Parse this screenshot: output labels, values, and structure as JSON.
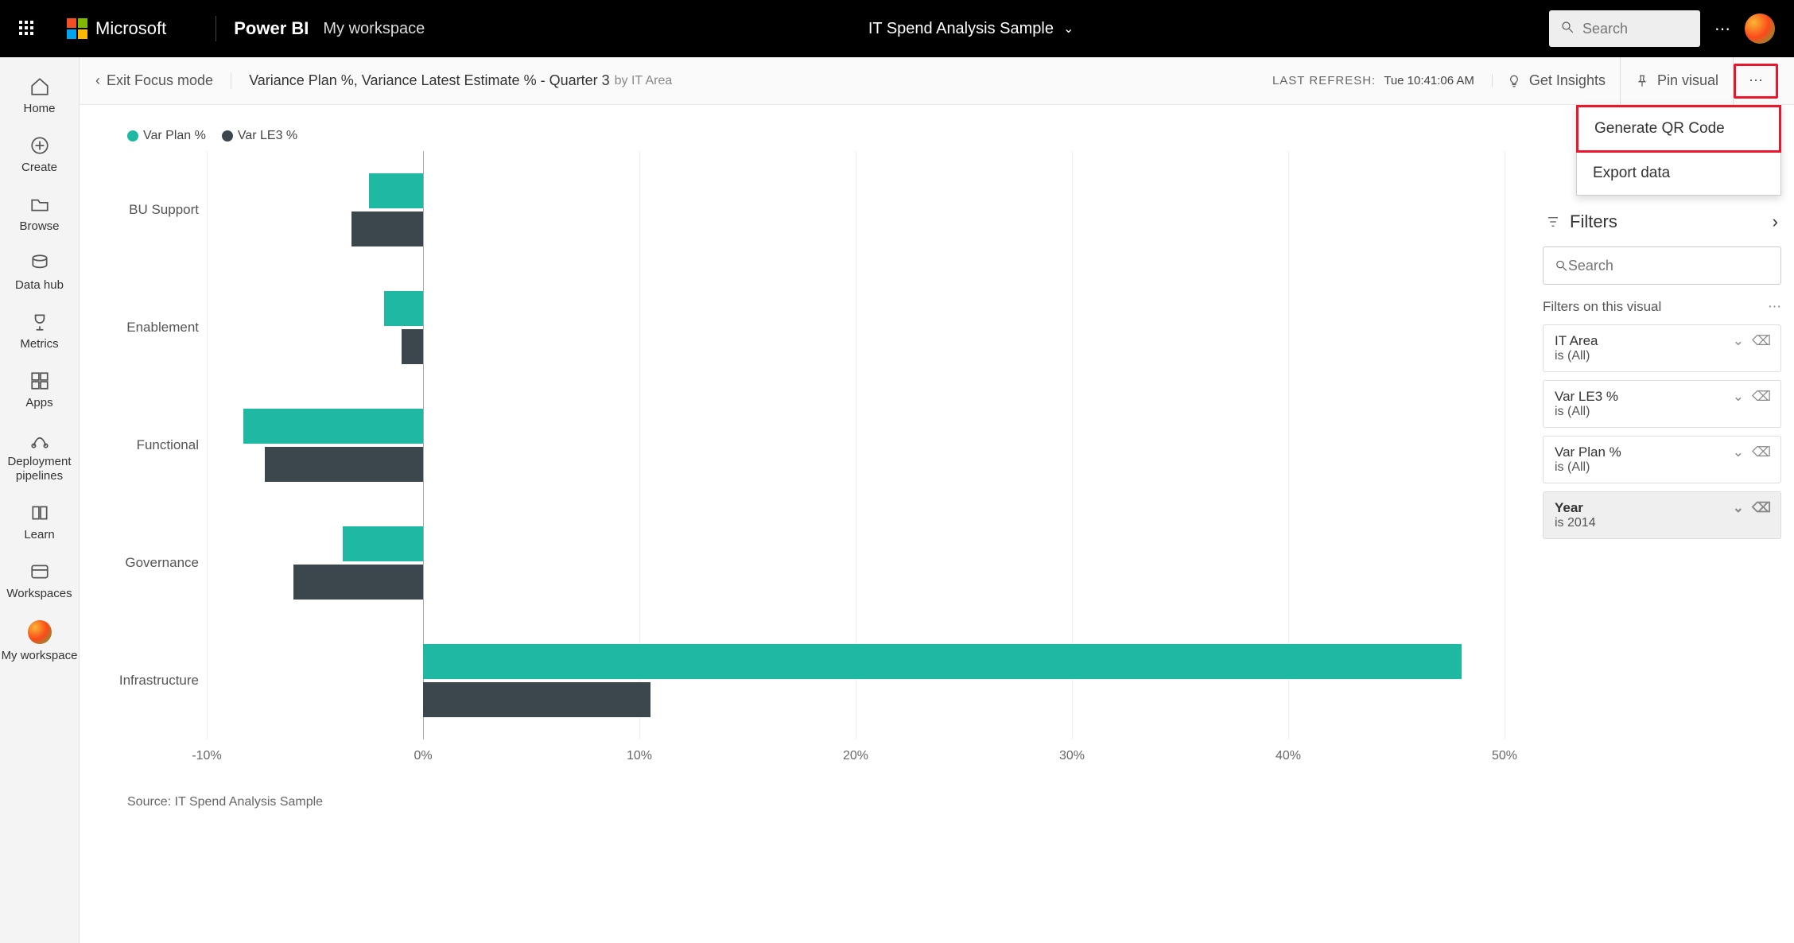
{
  "topbar": {
    "brand": "Microsoft",
    "product": "Power BI",
    "workspace": "My workspace",
    "doc_title": "IT Spend Analysis Sample",
    "search_placeholder": "Search"
  },
  "sidebar": {
    "items": [
      {
        "label": "Home"
      },
      {
        "label": "Create"
      },
      {
        "label": "Browse"
      },
      {
        "label": "Data hub"
      },
      {
        "label": "Metrics"
      },
      {
        "label": "Apps"
      },
      {
        "label": "Deployment pipelines"
      },
      {
        "label": "Learn"
      },
      {
        "label": "Workspaces"
      },
      {
        "label": "My workspace"
      }
    ]
  },
  "subheader": {
    "exit": "Exit Focus mode",
    "title": "Variance Plan %, Variance Latest Estimate % - Quarter 3",
    "subtitle": "by IT Area",
    "refresh_label": "LAST REFRESH:",
    "refresh_time": "Tue 10:41:06 AM",
    "get_insights": "Get Insights",
    "pin_visual": "Pin visual"
  },
  "dropdown": {
    "generate_qr": "Generate QR Code",
    "export_data": "Export data"
  },
  "legend": {
    "var_plan": "Var Plan %",
    "var_le3": "Var LE3 %"
  },
  "source": "Source: IT Spend Analysis Sample",
  "filters": {
    "heading": "Filters",
    "search_placeholder": "Search",
    "subhead": "Filters on this visual",
    "cards": [
      {
        "name": "IT Area",
        "value": "is (All)"
      },
      {
        "name": "Var LE3 %",
        "value": "is (All)"
      },
      {
        "name": "Var Plan %",
        "value": "is (All)"
      },
      {
        "name": "Year",
        "value": "is 2014"
      }
    ]
  },
  "colors": {
    "teal": "#1fb9a3",
    "slate": "#3c464d"
  },
  "chart_data": {
    "type": "bar",
    "orientation": "horizontal",
    "title": "Variance Plan %, Variance Latest Estimate % - Quarter 3 by IT Area",
    "xlabel": "",
    "ylabel": "",
    "xlim": [
      -10,
      50
    ],
    "x_ticks": [
      -10,
      0,
      10,
      20,
      30,
      40,
      50
    ],
    "categories": [
      "BU Support",
      "Enablement",
      "Functional",
      "Governance",
      "Infrastructure"
    ],
    "series": [
      {
        "name": "Var Plan %",
        "color": "#1fb9a3",
        "values": [
          -2.5,
          -1.8,
          -8.3,
          -3.7,
          48
        ]
      },
      {
        "name": "Var LE3 %",
        "color": "#3c464d",
        "values": [
          -3.3,
          -1.0,
          -7.3,
          -6.0,
          10.5
        ]
      }
    ],
    "source": "IT Spend Analysis Sample"
  }
}
